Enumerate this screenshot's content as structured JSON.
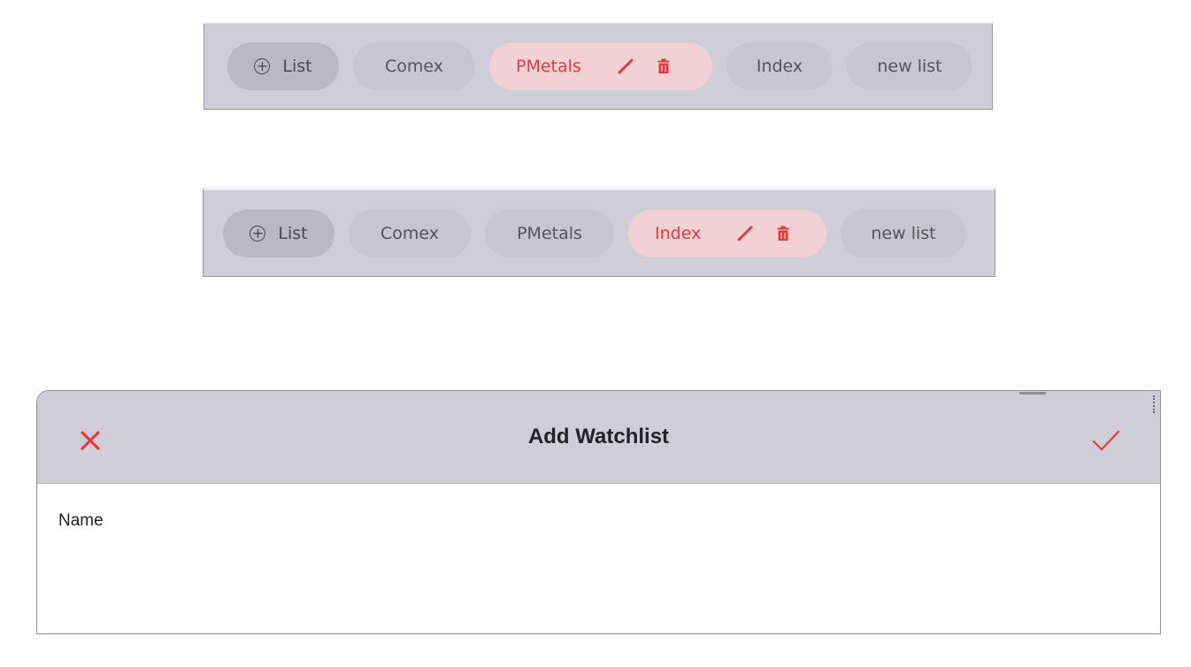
{
  "tab_bars": [
    {
      "add_chip": {
        "icon": "plus-circle-icon",
        "label": "List"
      },
      "chips": [
        {
          "label": "Comex",
          "active": false
        },
        {
          "label": "PMetals",
          "active": true
        },
        {
          "label": "Index",
          "active": false
        },
        {
          "label": "new list",
          "active": false
        }
      ]
    },
    {
      "add_chip": {
        "icon": "plus-circle-icon",
        "label": "List"
      },
      "chips": [
        {
          "label": "Comex",
          "active": false
        },
        {
          "label": "PMetals",
          "active": false
        },
        {
          "label": "Index",
          "active": true
        },
        {
          "label": "new list",
          "active": false
        }
      ]
    }
  ],
  "dialog": {
    "title": "Add Watchlist",
    "close_icon": "close-icon",
    "confirm_icon": "checkmark-icon",
    "name_label": "Name"
  },
  "colors": {
    "bar_background": "#cfced8",
    "chip_background": "#c6c5d0",
    "active_chip_background": "#f2d1d5",
    "accent_red": "#e23b3b",
    "text_gray": "#55545e"
  }
}
